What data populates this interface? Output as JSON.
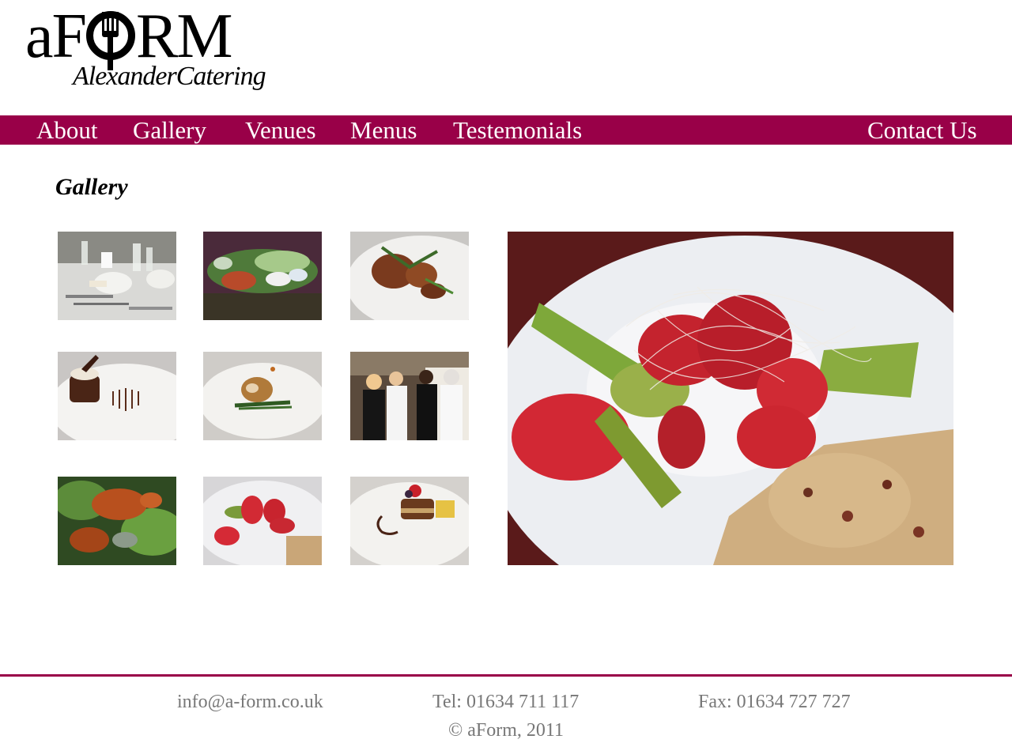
{
  "brand": {
    "logo_word": "aFORM",
    "logo_tagline": "AlexanderCatering",
    "accent_color": "#990048"
  },
  "nav": {
    "items": [
      {
        "label": "About"
      },
      {
        "label": "Gallery"
      },
      {
        "label": "Venues"
      },
      {
        "label": "Menus"
      },
      {
        "label": "Testemonials"
      }
    ],
    "contact_label": "Contact Us"
  },
  "page": {
    "title": "Gallery"
  },
  "gallery": {
    "thumbnails": [
      {
        "subject": "table-setting"
      },
      {
        "subject": "seafood-display"
      },
      {
        "subject": "roast-dish"
      },
      {
        "subject": "chocolate-dessert"
      },
      {
        "subject": "stuffed-chicken"
      },
      {
        "subject": "catering-staff"
      },
      {
        "subject": "crab-platter"
      },
      {
        "subject": "strawberry-kiwi-dessert"
      },
      {
        "subject": "mousse-cake"
      }
    ],
    "selected": {
      "subject": "strawberry-kiwi-dessert"
    }
  },
  "footer": {
    "email": "info@a-form.co.uk",
    "tel": "Tel: 01634 711 117",
    "fax": "Fax: 01634 727 727",
    "copyright": "© aForm, 2011"
  }
}
